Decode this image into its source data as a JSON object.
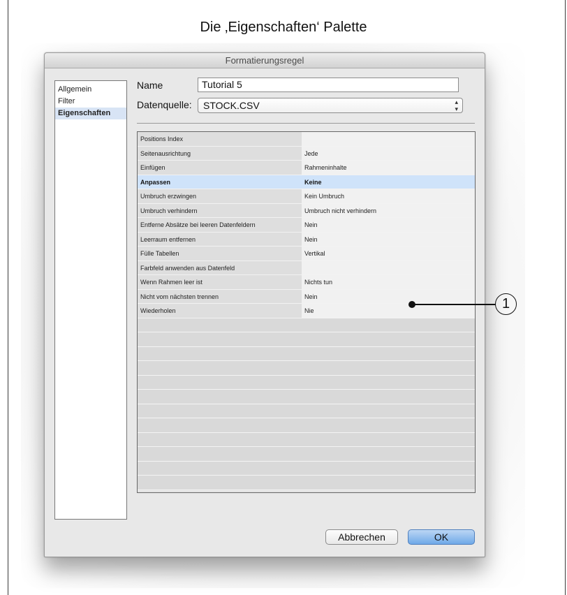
{
  "caption": "Die ‚Eigenschaften‘ Palette",
  "window": {
    "title": "Formatierungsregel"
  },
  "sidebar": {
    "items": [
      {
        "label": "Allgemein"
      },
      {
        "label": "Filter"
      },
      {
        "label": "Eigenschaften"
      }
    ],
    "selected": "Eigenschaften"
  },
  "form": {
    "name_label": "Name",
    "name_value": "Tutorial 5",
    "datasource_label": "Datenquelle:",
    "datasource_value": "STOCK.CSV"
  },
  "properties": {
    "rows": [
      {
        "key": "Positions Index",
        "value": ""
      },
      {
        "key": "Seitenausrichtung",
        "value": "Jede"
      },
      {
        "key": "Einfügen",
        "value": "Rahmeninhalte"
      },
      {
        "key": "Anpassen",
        "value": "Keine"
      },
      {
        "key": "Umbruch erzwingen",
        "value": "Kein Umbruch"
      },
      {
        "key": "Umbruch verhindern",
        "value": "Umbruch nicht verhindern"
      },
      {
        "key": "Entferne Absätze bei leeren Datenfeldern",
        "value": "Nein"
      },
      {
        "key": "Leerraum entfernen",
        "value": "Nein"
      },
      {
        "key": "Fülle Tabellen",
        "value": "Vertikal"
      },
      {
        "key": "Farbfeld anwenden aus Datenfeld",
        "value": ""
      },
      {
        "key": "Wenn Rahmen leer ist",
        "value": "Nichts tun"
      },
      {
        "key": "Nicht vom nächsten trennen",
        "value": "Nein"
      },
      {
        "key": "Wiederholen",
        "value": "Nie"
      }
    ],
    "selected_key": "Anpassen"
  },
  "buttons": {
    "cancel": "Abbrechen",
    "ok": "OK"
  },
  "callout": {
    "number": "1"
  },
  "colors": {
    "selection": "#cfe3fa",
    "ok_button": "#6fa9e8"
  }
}
